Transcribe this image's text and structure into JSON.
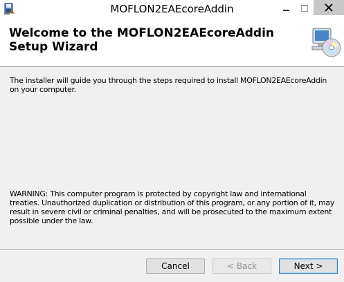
{
  "window": {
    "title": "MOFLON2EAEcoreAddin",
    "icons": {
      "app": "installer-disk-icon",
      "minimize": "minimize-icon",
      "maximize": "maximize-icon",
      "close": "close-icon"
    }
  },
  "banner": {
    "title": "Welcome to the MOFLON2EAEcoreAddin Setup Wizard",
    "icon": "computer-cd-icon"
  },
  "content": {
    "intro": "The installer will guide you through the steps required to install MOFLON2EAEcoreAddin on your computer.",
    "warning": "WARNING: This computer program is protected by copyright law and international treaties. Unauthorized duplication or distribution of this program, or any portion of it, may result in severe civil or criminal penalties, and will be prosecuted to the maximum extent possible under the law."
  },
  "buttons": {
    "cancel": "Cancel",
    "back": "< Back",
    "next": "Next >"
  },
  "colors": {
    "title_bar": "#ffffff",
    "close_button": "#c7c7c7",
    "dialog_background": "#f0f0f0",
    "default_button_border": "#3c7fb1"
  }
}
